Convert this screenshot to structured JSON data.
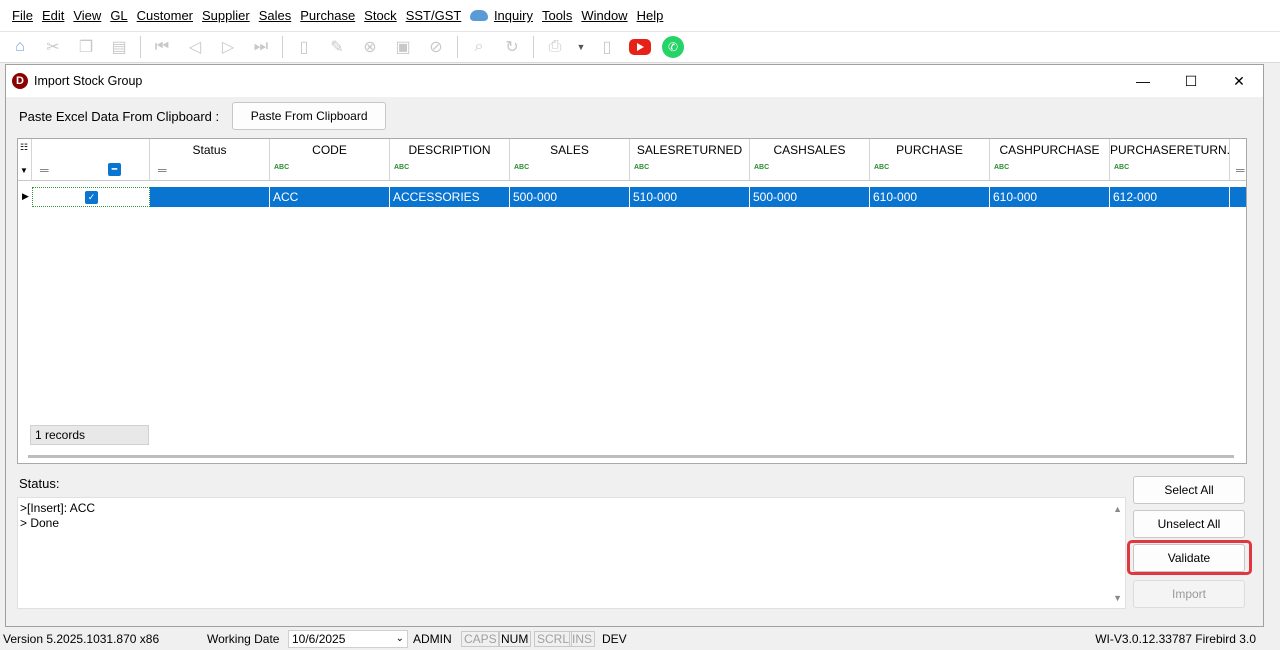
{
  "menu": [
    "File",
    "Edit",
    "View",
    "GL",
    "Customer",
    "Supplier",
    "Sales",
    "Purchase",
    "Stock",
    "SST/GST",
    "Inquiry",
    "Tools",
    "Window",
    "Help"
  ],
  "window": {
    "title": "Import Stock Group",
    "logo_letter": "D",
    "minimize": "—",
    "maximize": "☐",
    "close": "✕"
  },
  "paste": {
    "label": "Paste Excel Data From Clipboard :",
    "button": "Paste From Clipboard"
  },
  "grid": {
    "columns": [
      "Status",
      "CODE",
      "DESCRIPTION",
      "SALES",
      "SALESRETURNED",
      "CASHSALES",
      "PURCHASE",
      "CASHPURCHASE",
      "PURCHASERETURN..."
    ],
    "row": [
      "",
      "ACC",
      "ACCESSORIES",
      "500-000",
      "510-000",
      "500-000",
      "610-000",
      "610-000",
      "612-000"
    ],
    "records": "1 records"
  },
  "status": {
    "label": "Status:",
    "lines": [
      ">[Insert]: ACC",
      "> Done"
    ]
  },
  "buttons": {
    "select_all": "Select All",
    "unselect_all": "Unselect All",
    "validate": "Validate",
    "import": "Import"
  },
  "statusbar": {
    "version": "Version 5.2025.1031.870 x86",
    "working_date_label": "Working Date",
    "working_date": "10/6/2025",
    "user": "ADMIN",
    "caps": "CAPS",
    "num": "NUM",
    "scrl": "SCRL",
    "ins": "INS",
    "dev": "DEV",
    "db": "WI-V3.0.12.33787 Firebird 3.0"
  }
}
